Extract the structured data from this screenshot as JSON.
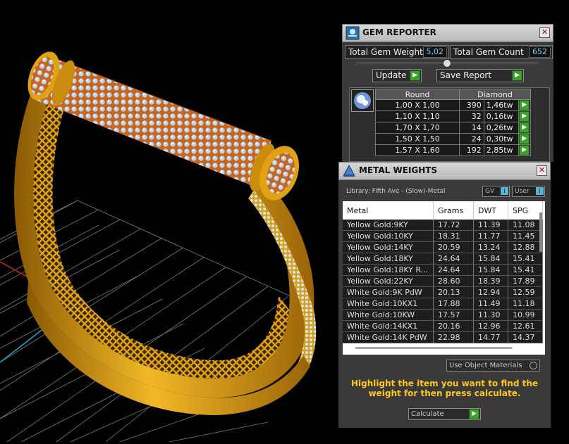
{
  "colors": {
    "gold": "#e0a213",
    "diamond": "#bcd6f2",
    "prong": "#d9752a",
    "panel_bg": "#3a3a3a",
    "accent_green": "#3aa12a",
    "hint_yellow": "#ffc61a"
  },
  "gem_reporter": {
    "title": "GEM REPORTER",
    "icon": "gem-report-icon",
    "total_gem_weight_label": "Total Gem Weight",
    "total_gem_weight": "5,02",
    "total_gem_count_label": "Total Gem Count",
    "total_gem_count": "652",
    "update_label": "Update",
    "save_report_label": "Save Report",
    "table": {
      "headers": [
        "Round",
        "Diamond"
      ],
      "rows": [
        {
          "size": "1,00 X 1,00",
          "count": "390",
          "weight": "1,46tw"
        },
        {
          "size": "1,10 X 1,10",
          "count": "32",
          "weight": "0,16tw"
        },
        {
          "size": "1,70 X 1,70",
          "count": "14",
          "weight": "0,26tw"
        },
        {
          "size": "1,50 X 1,50",
          "count": "24",
          "weight": "0,30tw"
        },
        {
          "size": "1,57 X 1,60",
          "count": "192",
          "weight": "2,85tw"
        }
      ]
    }
  },
  "metal_weights": {
    "title": "METAL WEIGHTS",
    "icon": "metal-weights-icon",
    "library": "Library: Fifth Ave - (Slow)-Metal",
    "gv_label": "GV",
    "user_label": "User",
    "columns": [
      "Metal",
      "Grams",
      "DWT",
      "SPG"
    ],
    "rows": [
      [
        "Yellow Gold:9KY",
        "17.72",
        "11.39",
        "11.08"
      ],
      [
        "Yellow Gold:10KY",
        "18.31",
        "11.77",
        "11.45"
      ],
      [
        "Yellow Gold:14KY",
        "20.59",
        "13.24",
        "12.88"
      ],
      [
        "Yellow Gold:18KY",
        "24.64",
        "15.84",
        "15.41"
      ],
      [
        "Yellow Gold:18KY R...",
        "24.64",
        "15.84",
        "15.41"
      ],
      [
        "Yellow Gold:22KY",
        "28.60",
        "18.39",
        "17.89"
      ],
      [
        "White Gold:9K PdW",
        "20.13",
        "12.94",
        "12.59"
      ],
      [
        "White Gold:10KX1",
        "17.88",
        "11.49",
        "11.18"
      ],
      [
        "White Gold:10KW",
        "17.57",
        "11.30",
        "10.99"
      ],
      [
        "White Gold:14KX1",
        "20.16",
        "12.96",
        "12.61"
      ],
      [
        "White Gold:14K PdW",
        "22.98",
        "14.77",
        "14.37"
      ]
    ],
    "use_object_materials": "Use Object Materials",
    "hint": "Highlight the item you want to find the weight for then press calculate.",
    "calculate_label": "Calculate"
  }
}
